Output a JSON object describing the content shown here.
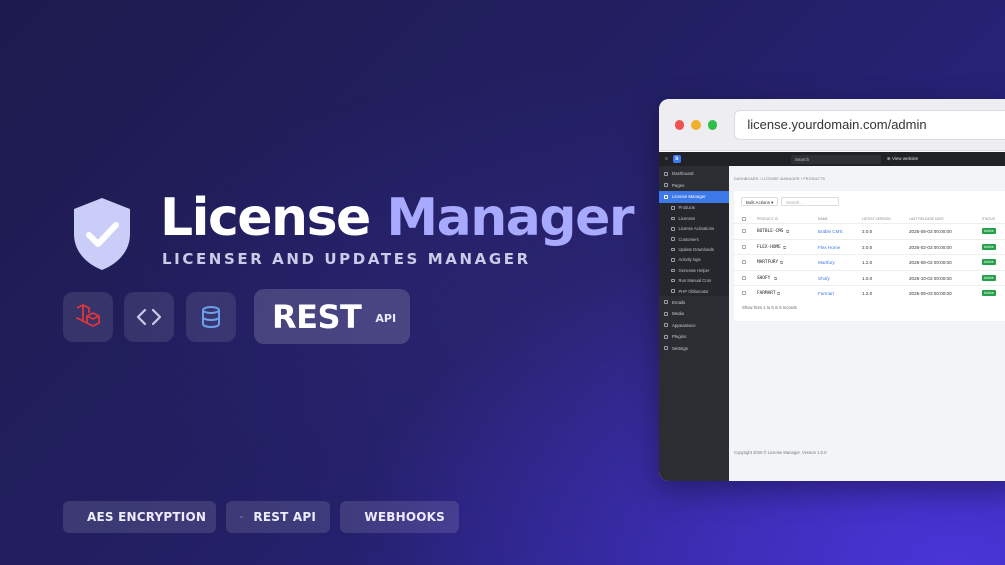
{
  "hero": {
    "title_1": "License",
    "title_2": "Manager",
    "subtitle": "LICENSER AND UPDATES MANAGER"
  },
  "tech": {
    "icons": [
      "laravel-icon",
      "code-icon",
      "database-icon"
    ],
    "rest_big": "REST",
    "rest_small": "API"
  },
  "features": [
    {
      "icon": "shield-icon",
      "label": "AES ENCRYPTION"
    },
    {
      "icon": "code-icon",
      "label": "REST API"
    },
    {
      "icon": "bell-icon",
      "label": "WEBHOOKS"
    }
  ],
  "browser": {
    "url": "license.yourdomain.com/admin",
    "topbar": {
      "logo": "b",
      "search": "Search",
      "view_website": "View website"
    },
    "sidebar": {
      "items": [
        {
          "label": "Dashboard"
        },
        {
          "label": "Pages"
        },
        {
          "label": "License Manager",
          "active": true
        }
      ],
      "sub_items": [
        {
          "label": "Products"
        },
        {
          "label": "Licenses"
        },
        {
          "label": "License Activations"
        },
        {
          "label": "Customers"
        },
        {
          "label": "Update Downloads"
        },
        {
          "label": "Activity logs"
        },
        {
          "label": "Generate Helper"
        },
        {
          "label": "Run Manual Cron"
        },
        {
          "label": "PHP Obfuscator"
        }
      ],
      "items_after": [
        {
          "label": "Emails"
        },
        {
          "label": "Media"
        },
        {
          "label": "Appearance"
        },
        {
          "label": "Plugins"
        },
        {
          "label": "Settings"
        }
      ]
    },
    "breadcrumb": "DASHBOARD / LICENSE MANAGER / PRODUCTS",
    "bulk_actions": "Bulk Actions",
    "search_placeholder": "Search...",
    "add_button": "+",
    "table": {
      "headers": [
        "PRODUCT ID",
        "NAME",
        "LATEST VERSION",
        "LAST RELEASE DATE",
        "STATUS"
      ],
      "rows": [
        {
          "id": "BOTBLE-CMS",
          "name": "Botble CMS",
          "version": "2.0.0",
          "date": "2025-08-03 00:00:00",
          "status": "Active"
        },
        {
          "id": "FLEX-HOME",
          "name": "Flex Home",
          "version": "2.0.0",
          "date": "2026-02-03 00:00:00",
          "status": "Active"
        },
        {
          "id": "MARTFURY",
          "name": "Martfury",
          "version": "1.2.0",
          "date": "2025-08-03 00:00:00",
          "status": "Active"
        },
        {
          "id": "SHOFY",
          "name": "Shofy",
          "version": "1.0.0",
          "date": "2025-10-03 00:00:00",
          "status": "Active"
        },
        {
          "id": "FARMART",
          "name": "Farmart",
          "version": "1.2.0",
          "date": "2025-09-03 00:00:00",
          "status": "Active"
        }
      ]
    },
    "showing": "Show from 1 to 5 in 5 records",
    "footer": "Copyright 2026 © License Manager. Version 1.0.0"
  }
}
